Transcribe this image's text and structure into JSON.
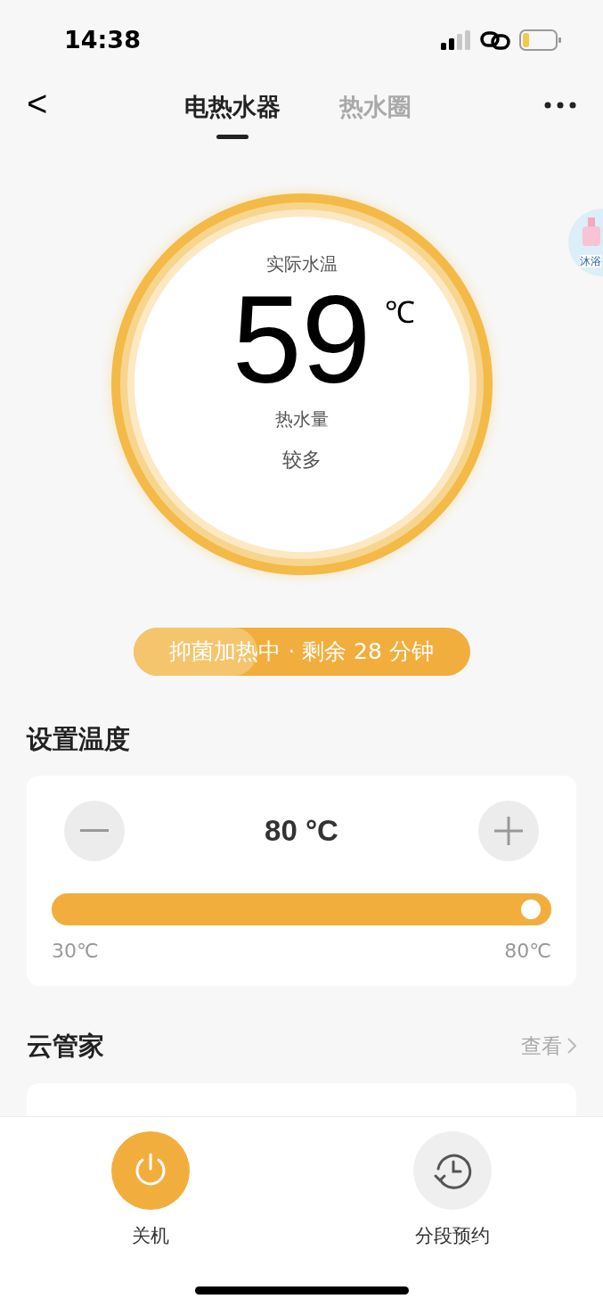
{
  "status_bar": {
    "time": "14:38"
  },
  "nav": {
    "back": "<",
    "tabs": [
      {
        "label": "电热水器",
        "selected": true
      },
      {
        "label": "热水圈",
        "selected": false
      }
    ]
  },
  "floating_badge": {
    "label": "沐浴"
  },
  "gauge": {
    "caption": "实际水温",
    "temperature": "59",
    "unit": "℃",
    "hot_water_label": "热水量",
    "hot_water_value": "较多"
  },
  "status_pill": {
    "text": "抑菌加热中 · 剩余 28 分钟",
    "level": 0.37
  },
  "set_temperature": {
    "title": "设置温度",
    "value": "80 °C",
    "level": 1,
    "min_label": "30℃",
    "max_label": "80℃"
  },
  "cloud_butler": {
    "title": "云管家",
    "link": "查看"
  },
  "bottom_actions": [
    {
      "kind": "power",
      "label": "关机",
      "on": true
    },
    {
      "kind": "schedule",
      "label": "分段预约",
      "on": false
    }
  ]
}
